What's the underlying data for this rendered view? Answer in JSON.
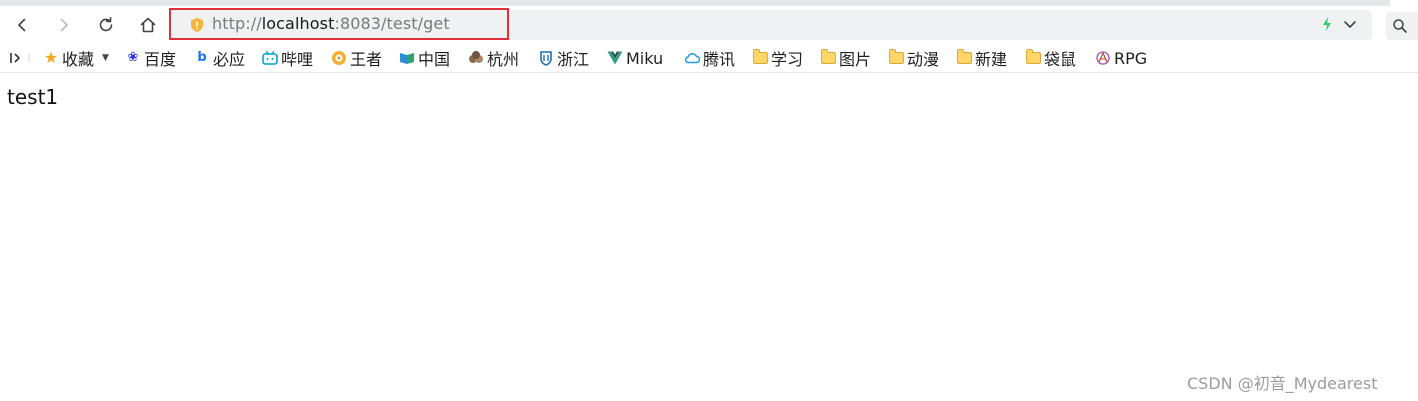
{
  "browser": {
    "address_bar": {
      "url_scheme": "http://",
      "url_host": "localhost",
      "url_rest": ":8083/test/get",
      "security_icon": "shield-warning-icon",
      "highlight_color": "#e0303b"
    },
    "nav": {
      "back_icon": "back-icon",
      "forward_icon": "forward-icon",
      "reload_icon": "reload-icon",
      "home_icon": "home-icon"
    }
  },
  "bookmarks_bar": {
    "items": [
      {
        "label": "收藏",
        "icon": "star-icon",
        "color": "#f5a623"
      },
      {
        "label": "百度",
        "icon": "baidu-icon",
        "color": "#2932e1"
      },
      {
        "label": "必应",
        "icon": "bing-icon",
        "color": "#1a73e8"
      },
      {
        "label": "哔哩",
        "icon": "bilibili-icon",
        "color": "#00a1d6"
      },
      {
        "label": "王者",
        "icon": "game-icon",
        "color": "#e8a33d"
      },
      {
        "label": "中国",
        "icon": "flag-icon",
        "color": "#2a8dd4"
      },
      {
        "label": "杭州",
        "icon": "hangzhou-icon",
        "color": "#8a6b4e"
      },
      {
        "label": "浙江",
        "icon": "zhejiang-icon",
        "color": "#1d6fb8"
      },
      {
        "label": "Miku",
        "icon": "vue-icon",
        "color": "#2f9e7b"
      },
      {
        "label": "腾讯",
        "icon": "cloud-icon",
        "color": "#1f9be0"
      },
      {
        "label": "学习",
        "icon": "folder-icon",
        "color": "#ffd766"
      },
      {
        "label": "图片",
        "icon": "folder-icon",
        "color": "#ffd766"
      },
      {
        "label": "动漫",
        "icon": "folder-icon",
        "color": "#ffd766"
      },
      {
        "label": "新建",
        "icon": "folder-icon",
        "color": "#ffd766"
      },
      {
        "label": "袋鼠",
        "icon": "folder-icon",
        "color": "#ffd766"
      },
      {
        "label": "RPG",
        "icon": "rpg-icon",
        "color": "#9b59b6"
      }
    ]
  },
  "page": {
    "body_text": "test1"
  },
  "watermark": "CSDN @初音_Mydearest"
}
